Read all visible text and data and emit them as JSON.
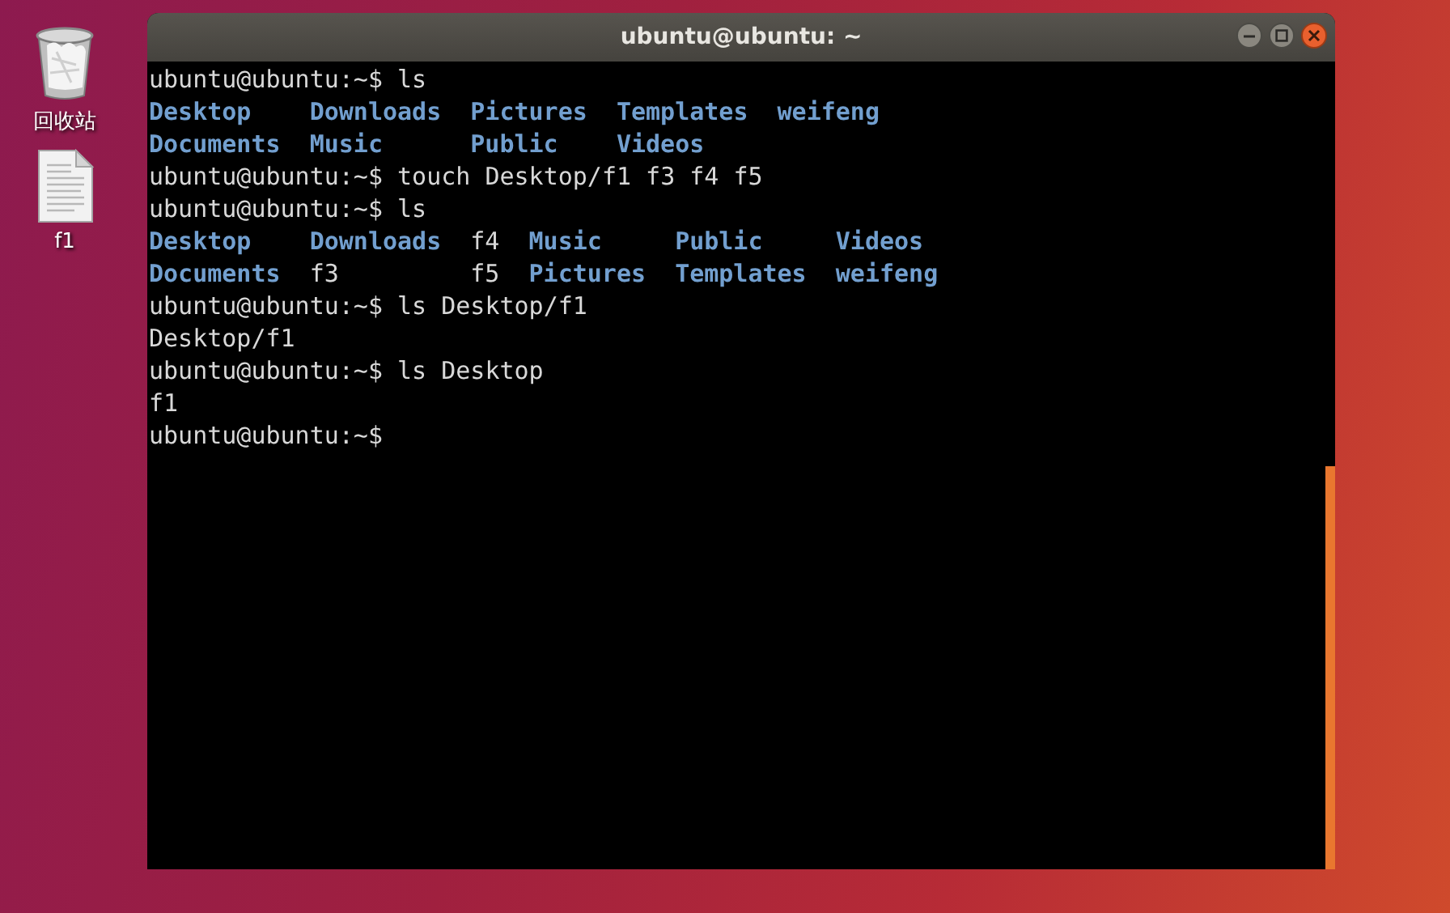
{
  "desktop_icons": [
    {
      "kind": "trash",
      "label": "回收站"
    },
    {
      "kind": "file",
      "label": "f1"
    }
  ],
  "window": {
    "title": "ubuntu@ubuntu: ~"
  },
  "terminal": {
    "lines": [
      {
        "kind": "command",
        "text": "ubuntu@ubuntu:~$ ls"
      },
      {
        "kind": "listing",
        "columns": [
          [
            {
              "kind": "dir",
              "name": "Desktop"
            },
            {
              "kind": "dir",
              "name": "Documents"
            }
          ],
          [
            {
              "kind": "dir",
              "name": "Downloads"
            },
            {
              "kind": "dir",
              "name": "Music"
            }
          ],
          [
            {
              "kind": "dir",
              "name": "Pictures"
            },
            {
              "kind": "dir",
              "name": "Public"
            }
          ],
          [
            {
              "kind": "dir",
              "name": "Templates"
            },
            {
              "kind": "dir",
              "name": "Videos"
            }
          ],
          [
            {
              "kind": "dir",
              "name": "weifeng"
            }
          ]
        ]
      },
      {
        "kind": "command",
        "text": "ubuntu@ubuntu:~$ touch Desktop/f1 f3 f4 f5"
      },
      {
        "kind": "command",
        "text": "ubuntu@ubuntu:~$ ls"
      },
      {
        "kind": "listing",
        "columns": [
          [
            {
              "kind": "dir",
              "name": "Desktop"
            },
            {
              "kind": "dir",
              "name": "Documents"
            }
          ],
          [
            {
              "kind": "dir",
              "name": "Downloads"
            },
            {
              "kind": "file",
              "name": "f3"
            }
          ],
          [
            {
              "kind": "file",
              "name": "f4"
            },
            {
              "kind": "file",
              "name": "f5"
            }
          ],
          [
            {
              "kind": "dir",
              "name": "Music"
            },
            {
              "kind": "dir",
              "name": "Pictures"
            }
          ],
          [
            {
              "kind": "dir",
              "name": "Public"
            },
            {
              "kind": "dir",
              "name": "Templates"
            }
          ],
          [
            {
              "kind": "dir",
              "name": "Videos"
            },
            {
              "kind": "dir",
              "name": "weifeng"
            }
          ]
        ]
      },
      {
        "kind": "command",
        "text": "ubuntu@ubuntu:~$ ls Desktop/f1"
      },
      {
        "kind": "output",
        "text": "Desktop/f1"
      },
      {
        "kind": "command",
        "text": "ubuntu@ubuntu:~$ ls Desktop"
      },
      {
        "kind": "output",
        "text": "f1"
      },
      {
        "kind": "command",
        "text": "ubuntu@ubuntu:~$"
      }
    ]
  }
}
